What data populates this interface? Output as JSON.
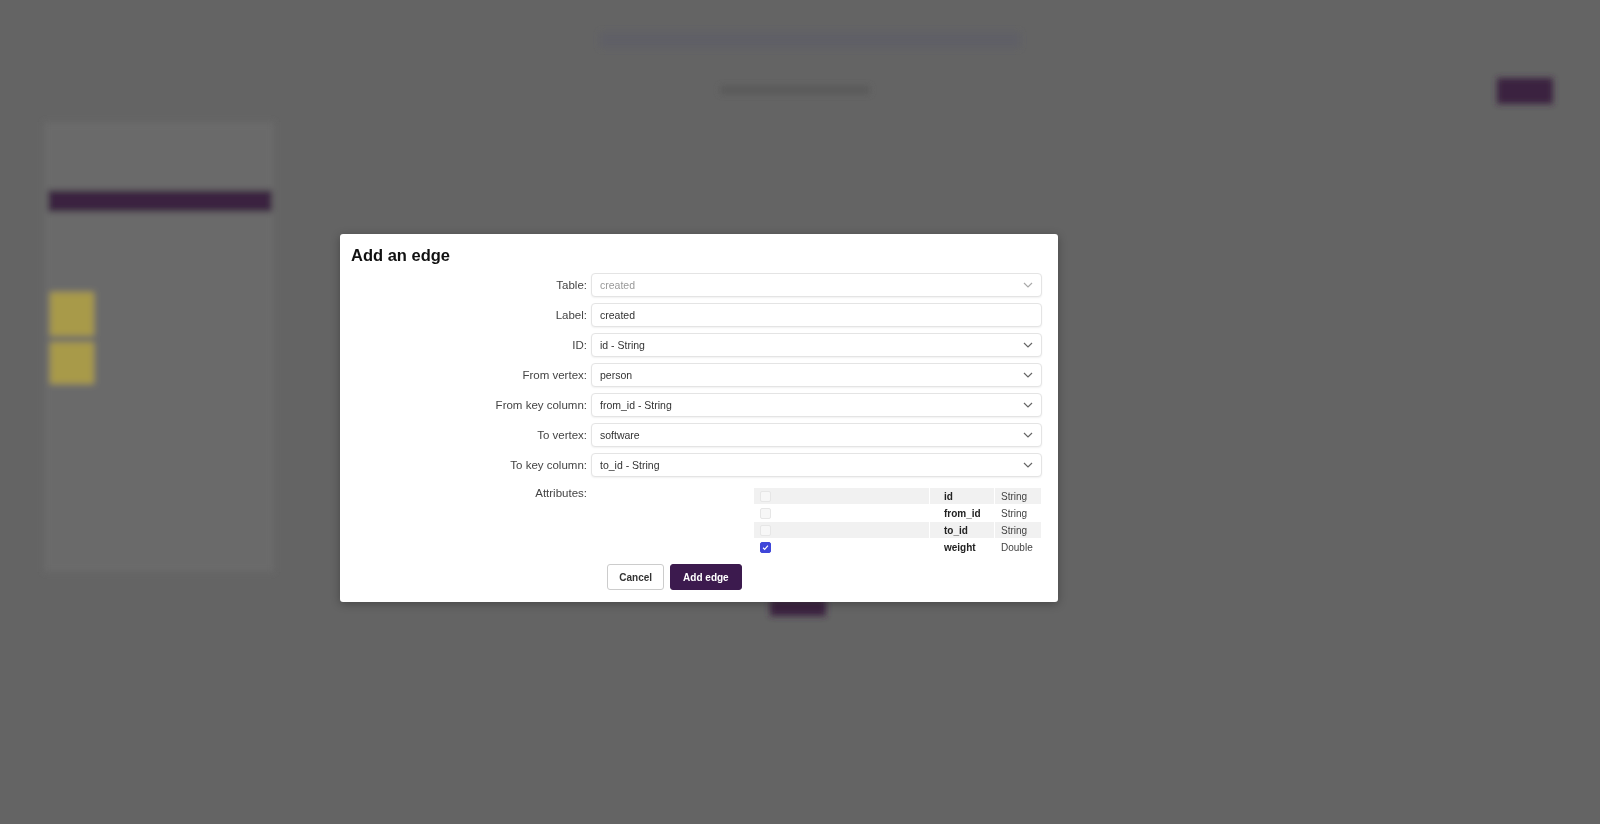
{
  "dialog": {
    "title": "Add an edge",
    "fields": [
      {
        "label": "Table:",
        "kind": "select",
        "value": "created",
        "disabled": true
      },
      {
        "label": "Label:",
        "kind": "input",
        "value": "created",
        "disabled": false
      },
      {
        "label": "ID:",
        "kind": "select",
        "value": "id - String",
        "disabled": false
      },
      {
        "label": "From vertex:",
        "kind": "select",
        "value": "person",
        "disabled": false
      },
      {
        "label": "From key column:",
        "kind": "select",
        "value": "from_id - String",
        "disabled": false
      },
      {
        "label": "To vertex:",
        "kind": "select",
        "value": "software",
        "disabled": false
      },
      {
        "label": "To key column:",
        "kind": "select",
        "value": "to_id - String",
        "disabled": false
      }
    ],
    "attributes_label": "Attributes:",
    "attributes": [
      {
        "name": "id",
        "type": "String",
        "checked": false
      },
      {
        "name": "from_id",
        "type": "String",
        "checked": false
      },
      {
        "name": "to_id",
        "type": "String",
        "checked": false
      },
      {
        "name": "weight",
        "type": "Double",
        "checked": true
      }
    ],
    "buttons": [
      {
        "label": "Cancel",
        "kind": "secondary"
      },
      {
        "label": "Add edge",
        "kind": "primary"
      }
    ]
  }
}
